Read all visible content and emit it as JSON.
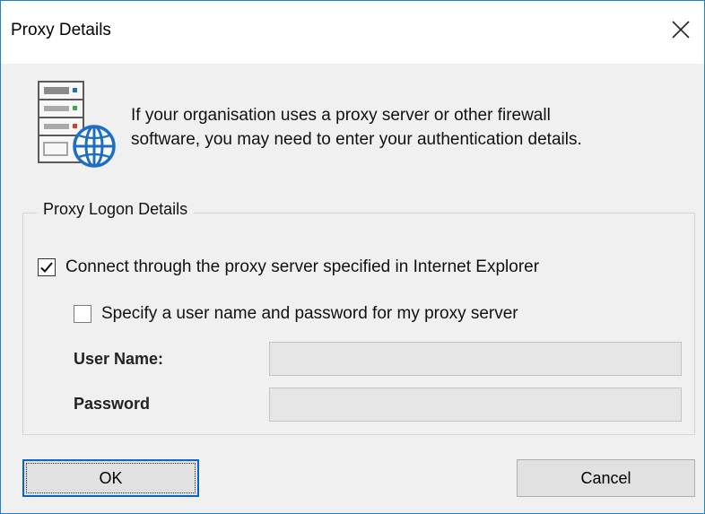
{
  "window": {
    "title": "Proxy Details",
    "close_icon": "close-icon"
  },
  "header": {
    "icon": "server-globe-icon",
    "message_line1": "If your organisation uses a proxy server or other firewall",
    "message_line2": "software, you may need to enter your authentication details."
  },
  "logon_group": {
    "legend": "Proxy Logon Details",
    "use_ie_proxy": {
      "label": "Connect through the proxy server specified in Internet Explorer",
      "checked": true
    },
    "specify_credentials": {
      "label": "Specify a user name and password for my proxy server",
      "checked": false
    },
    "username": {
      "label": "User Name:",
      "value": ""
    },
    "password": {
      "label": "Password",
      "value": ""
    }
  },
  "buttons": {
    "ok_label": "OK",
    "cancel_label": "Cancel"
  },
  "colors": {
    "window_border": "#1883d7",
    "default_button_border": "#0a64c8",
    "globe_blue": "#1e6fc4"
  }
}
